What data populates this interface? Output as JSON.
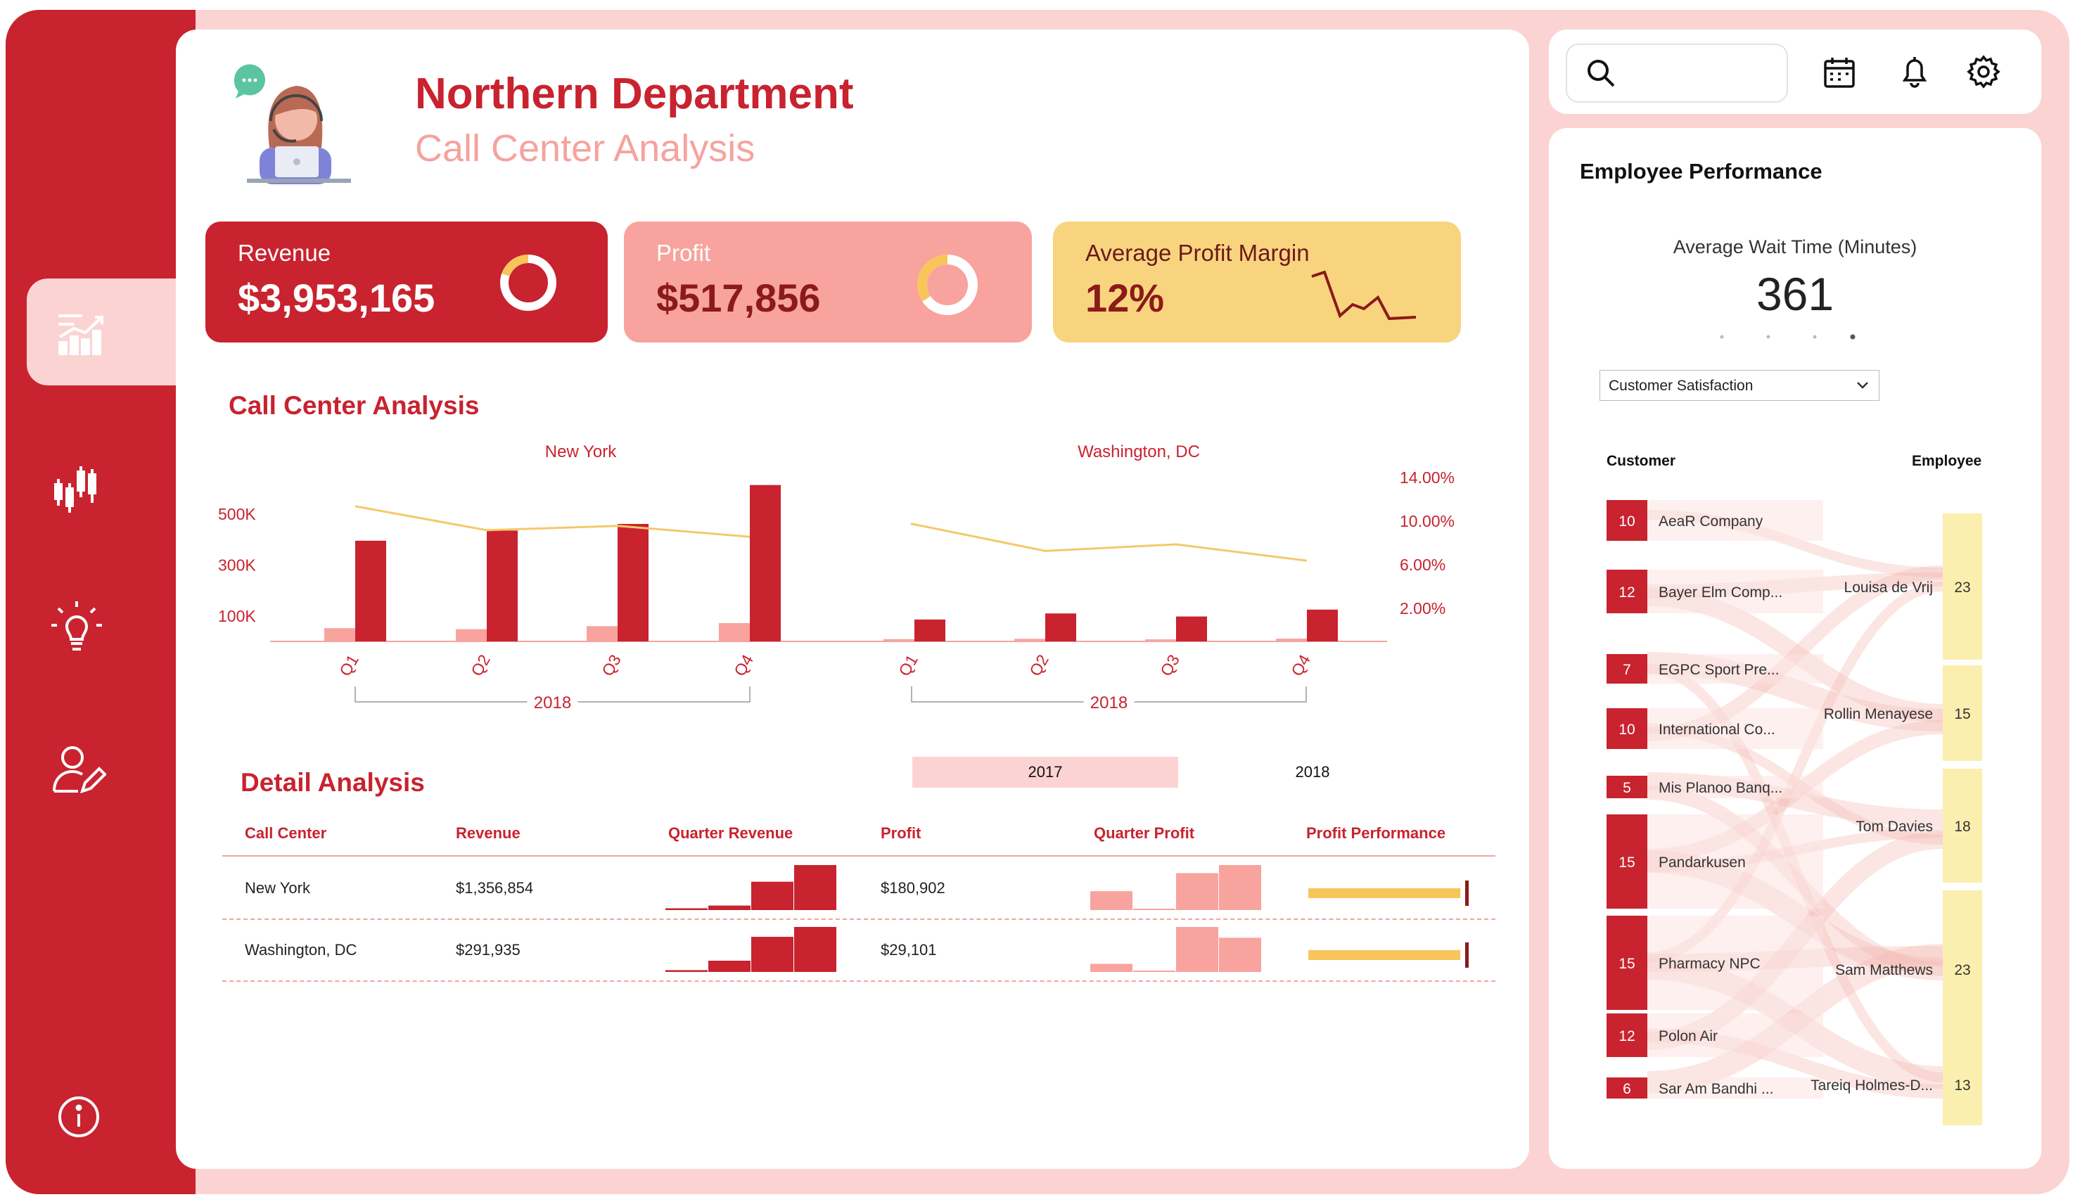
{
  "header": {
    "title": "Northern Department",
    "subtitle": "Call Center Analysis"
  },
  "kpis": [
    {
      "label": "Revenue",
      "value": "$3,953,165"
    },
    {
      "label": "Profit",
      "value": "$517,856"
    },
    {
      "label": "Average Profit Margin",
      "value": "12%"
    }
  ],
  "colors": {
    "brand_red": "#c8232f",
    "salmon": "#f8a39e",
    "pale_pink": "#fcd3d3",
    "gold": "#f7c55a",
    "amber_card": "#f9d47f",
    "line_yellow": "#f4c96c"
  },
  "nav": {
    "items": [
      "chart-icon",
      "candlestick-icon",
      "lightbulb-icon",
      "user-edit-icon",
      "info-icon"
    ],
    "active": "chart-icon"
  },
  "call_center_section": {
    "title": "Call Center Analysis",
    "year_label_left": "2018",
    "year_label_right": "2018"
  },
  "chart_data": [
    {
      "type": "bar",
      "title": "New York",
      "categories": [
        "Q1",
        "Q2",
        "Q3",
        "Q4"
      ],
      "series": [
        {
          "values": [
            396000,
            436000,
            462000,
            615000
          ]
        },
        {
          "values": [
            52000,
            48000,
            60000,
            72000
          ]
        }
      ],
      "line": {
        "values": [
          12.4,
          10.2,
          10.6,
          9.6
        ]
      },
      "y_ticks": [
        "100K",
        "300K",
        "500K"
      ],
      "y2_ticks": [
        "2.00%",
        "6.00%",
        "10.00%",
        "14.00%"
      ],
      "ylim": [
        0,
        650000
      ],
      "y2lim": [
        0,
        16
      ]
    },
    {
      "type": "bar",
      "title": "Washington, DC",
      "categories": [
        "Q1",
        "Q2",
        "Q3",
        "Q4"
      ],
      "series": [
        {
          "values": [
            86000,
            110000,
            98000,
            125000
          ]
        },
        {
          "values": [
            9000,
            10000,
            8000,
            11000
          ]
        }
      ],
      "line": {
        "values": [
          10.8,
          8.3,
          8.9,
          7.4
        ]
      },
      "ylim": [
        0,
        650000
      ],
      "y2lim": [
        0,
        16
      ]
    }
  ],
  "detail": {
    "title": "Detail Analysis",
    "years": [
      "2017",
      "2018"
    ],
    "selected_year": "2017",
    "columns": [
      "Call Center",
      "Revenue",
      "Quarter Revenue",
      "Profit",
      "Quarter Profit",
      "Profit Performance"
    ],
    "rows": [
      {
        "call_center": "New York",
        "revenue": "$1,356,854",
        "profit": "$180,902",
        "quarter_revenue": [
          0.04,
          0.1,
          0.63,
          1.0
        ],
        "quarter_profit": [
          0.42,
          0.0,
          0.82,
          1.0
        ],
        "performance": 0.94
      },
      {
        "call_center": "Washington, DC",
        "revenue": "$291,935",
        "profit": "$29,101",
        "quarter_revenue": [
          0.04,
          0.25,
          0.78,
          1.0
        ],
        "quarter_profit": [
          0.18,
          0.0,
          1.0,
          0.76
        ],
        "performance": 0.94
      }
    ]
  },
  "topbar": {
    "icons": [
      "search-icon",
      "calendar-icon",
      "bell-icon",
      "gear-icon"
    ]
  },
  "employee_performance": {
    "title": "Employee Performance",
    "wait_time_label": "Average Wait Time (Minutes)",
    "wait_time_value": "361",
    "dropdown": {
      "value": "Customer Satisfaction"
    },
    "customer_header": "Customer",
    "employee_header": "Employee",
    "customers": [
      {
        "value": "10",
        "name": "AeaR Company"
      },
      {
        "value": "12",
        "name": "Bayer Elm Comp..."
      },
      {
        "value": "7",
        "name": "EGPC Sport Pre..."
      },
      {
        "value": "10",
        "name": "International Co..."
      },
      {
        "value": "5",
        "name": "Mis Planoo Banq..."
      },
      {
        "value": "15",
        "name": "Pandarkusen"
      },
      {
        "value": "15",
        "name": "Pharmacy NPC"
      },
      {
        "value": "12",
        "name": "Polon Air"
      },
      {
        "value": "6",
        "name": "Sar Am Bandhi ..."
      }
    ],
    "employees": [
      {
        "value": "23",
        "name": "Louisa de Vrij"
      },
      {
        "value": "15",
        "name": "Rollin Menayese"
      },
      {
        "value": "18",
        "name": "Tom Davies"
      },
      {
        "value": "23",
        "name": "Sam Matthews"
      },
      {
        "value": "13",
        "name": "Tareiq Holmes-D..."
      }
    ]
  }
}
